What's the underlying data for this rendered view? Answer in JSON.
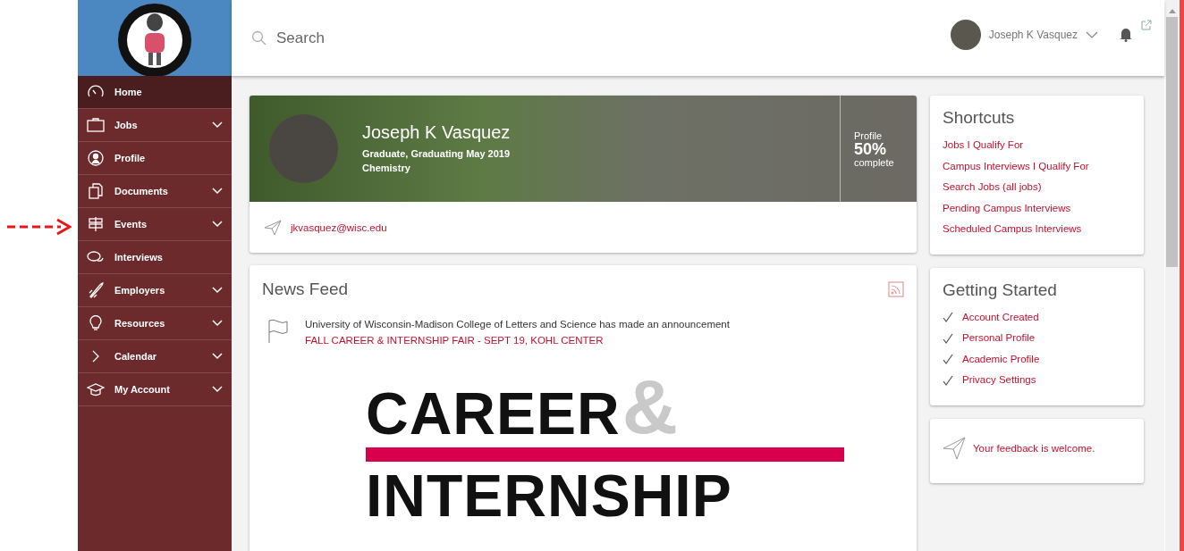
{
  "sidebar": {
    "items": [
      {
        "label": "Home",
        "expandable": false,
        "selected": true
      },
      {
        "label": "Jobs",
        "expandable": true,
        "selected": false
      },
      {
        "label": "Profile",
        "expandable": false,
        "selected": false
      },
      {
        "label": "Documents",
        "expandable": true,
        "selected": false
      },
      {
        "label": "Events",
        "expandable": true,
        "selected": false
      },
      {
        "label": "Interviews",
        "expandable": false,
        "selected": false
      },
      {
        "label": "Employers",
        "expandable": true,
        "selected": false
      },
      {
        "label": "Resources",
        "expandable": true,
        "selected": false
      },
      {
        "label": "Calendar",
        "expandable": true,
        "selected": false
      },
      {
        "label": "My Account",
        "expandable": true,
        "selected": false
      }
    ]
  },
  "top_bar": {
    "search": {
      "placeholder": "Search"
    },
    "user_name": "Joseph K Vasquez"
  },
  "profile_card": {
    "name": "Joseph K Vasquez",
    "status": "Graduate, Graduating May 2019",
    "major": "Chemistry",
    "completion_label": "Profile",
    "completion": "50%",
    "completion_suffix": "complete",
    "email": "jkvasquez@wisc.edu"
  },
  "news_feed": {
    "title": "News Feed",
    "items": [
      {
        "text": "University of Wisconsin-Madison College of Letters and Science has made an announcement",
        "link": "FALL CAREER & INTERNSHIP FAIR - SEPT 19, KOHL CENTER",
        "banner": [
          "CAREER",
          "&",
          "INTERNSHIP"
        ]
      }
    ]
  },
  "shortcuts": {
    "title": "Shortcuts",
    "links": [
      "Jobs I Qualify For",
      "Campus Interviews I Qualify For",
      "Search Jobs (all jobs)",
      "Pending Campus Interviews",
      "Scheduled Campus Interviews"
    ]
  },
  "getting_started": {
    "title": "Getting Started",
    "steps": [
      {
        "label": "Account Created",
        "checked": true
      },
      {
        "label": "Personal Profile",
        "checked": true
      },
      {
        "label": "Academic Profile",
        "checked": true
      },
      {
        "label": "Privacy Settings",
        "checked": true
      }
    ]
  },
  "feedback": {
    "text": "Your feedback is welcome."
  }
}
